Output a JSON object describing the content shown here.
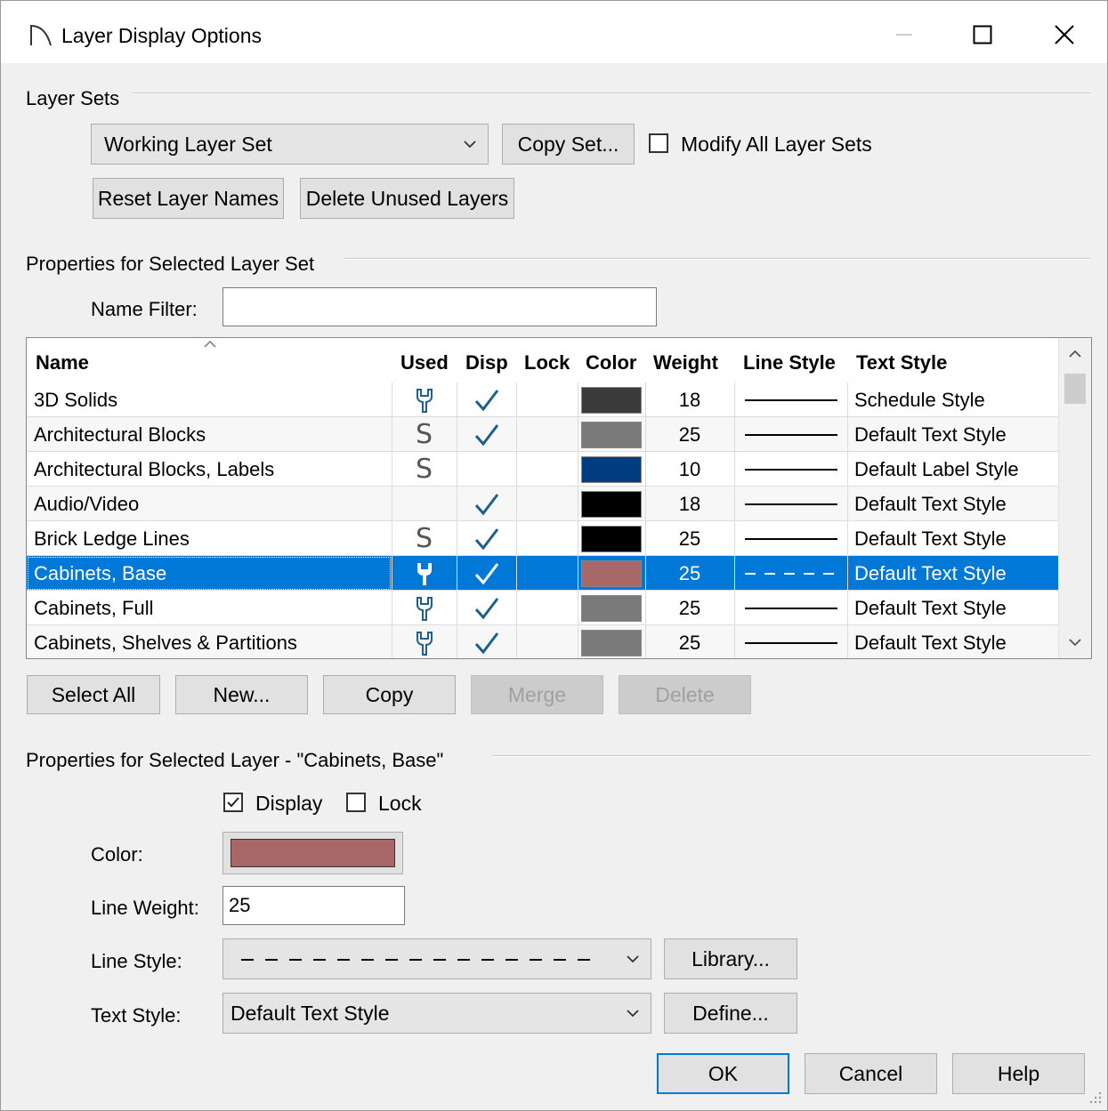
{
  "window": {
    "title": "Layer Display Options",
    "minimize_icon": "minimize-icon",
    "maximize_icon": "maximize-icon",
    "close_icon": "close-icon"
  },
  "layer_sets": {
    "group_label": "Layer Sets",
    "selected_set": "Working Layer Set",
    "copy_set_label": "Copy Set...",
    "modify_all_label": "Modify All Layer Sets",
    "modify_all_checked": false,
    "reset_names_label": "Reset Layer Names",
    "delete_unused_label": "Delete Unused Layers"
  },
  "properties_set": {
    "group_label": "Properties for Selected Layer Set",
    "name_filter_label": "Name Filter:",
    "name_filter_value": "",
    "columns": [
      "Name",
      "Used",
      "Disp",
      "Lock",
      "Color",
      "Weight",
      "Line Style",
      "Text Style"
    ],
    "rows": [
      {
        "name": "3D Solids",
        "used": "wrench",
        "disp": true,
        "lock": false,
        "color": "#3a3a3a",
        "weight": "18",
        "line": "solid",
        "text_style": "Schedule Style",
        "selected": false
      },
      {
        "name": "Architectural Blocks",
        "used": "S",
        "disp": true,
        "lock": false,
        "color": "#7a7a7a",
        "weight": "25",
        "line": "solid",
        "text_style": "Default Text Style",
        "selected": false
      },
      {
        "name": "Architectural Blocks, Labels",
        "used": "S",
        "disp": false,
        "lock": false,
        "color": "#003c80",
        "weight": "10",
        "line": "solid",
        "text_style": "Default Label Style",
        "selected": false
      },
      {
        "name": "Audio/Video",
        "used": "",
        "disp": true,
        "lock": false,
        "color": "#000000",
        "weight": "18",
        "line": "solid",
        "text_style": "Default Text Style",
        "selected": false
      },
      {
        "name": "Brick Ledge Lines",
        "used": "S",
        "disp": true,
        "lock": false,
        "color": "#000000",
        "weight": "25",
        "line": "solid",
        "text_style": "Default Text Style",
        "selected": false
      },
      {
        "name": "Cabinets,  Base",
        "used": "wrench",
        "disp": true,
        "lock": false,
        "color": "#a86868",
        "weight": "25",
        "line": "dashed",
        "text_style": "Default Text Style",
        "selected": true
      },
      {
        "name": "Cabinets,  Full",
        "used": "wrench",
        "disp": true,
        "lock": false,
        "color": "#7a7a7a",
        "weight": "25",
        "line": "solid",
        "text_style": "Default Text Style",
        "selected": false
      },
      {
        "name": "Cabinets,  Shelves & Partitions",
        "used": "wrench",
        "disp": true,
        "lock": false,
        "color": "#7a7a7a",
        "weight": "25",
        "line": "solid",
        "text_style": "Default Text Style",
        "selected": false
      }
    ],
    "buttons": {
      "select_all": "Select All",
      "new": "New...",
      "copy": "Copy",
      "merge": "Merge",
      "delete": "Delete"
    }
  },
  "properties_layer": {
    "group_label": "Properties for Selected Layer - \"Cabinets,  Base\"",
    "display_label": "Display",
    "display_checked": true,
    "lock_label": "Lock",
    "lock_checked": false,
    "color_label": "Color:",
    "color_value": "#a86868",
    "line_weight_label": "Line Weight:",
    "line_weight_value": "25",
    "line_style_label": "Line Style:",
    "library_label": "Library...",
    "text_style_label": "Text Style:",
    "text_style_value": "Default Text Style",
    "define_label": "Define..."
  },
  "dialog_buttons": {
    "ok": "OK",
    "cancel": "Cancel",
    "help": "Help"
  },
  "colors": {
    "selection": "#0078d7",
    "check": "#1f5f8b",
    "accent": "#0078d7"
  }
}
